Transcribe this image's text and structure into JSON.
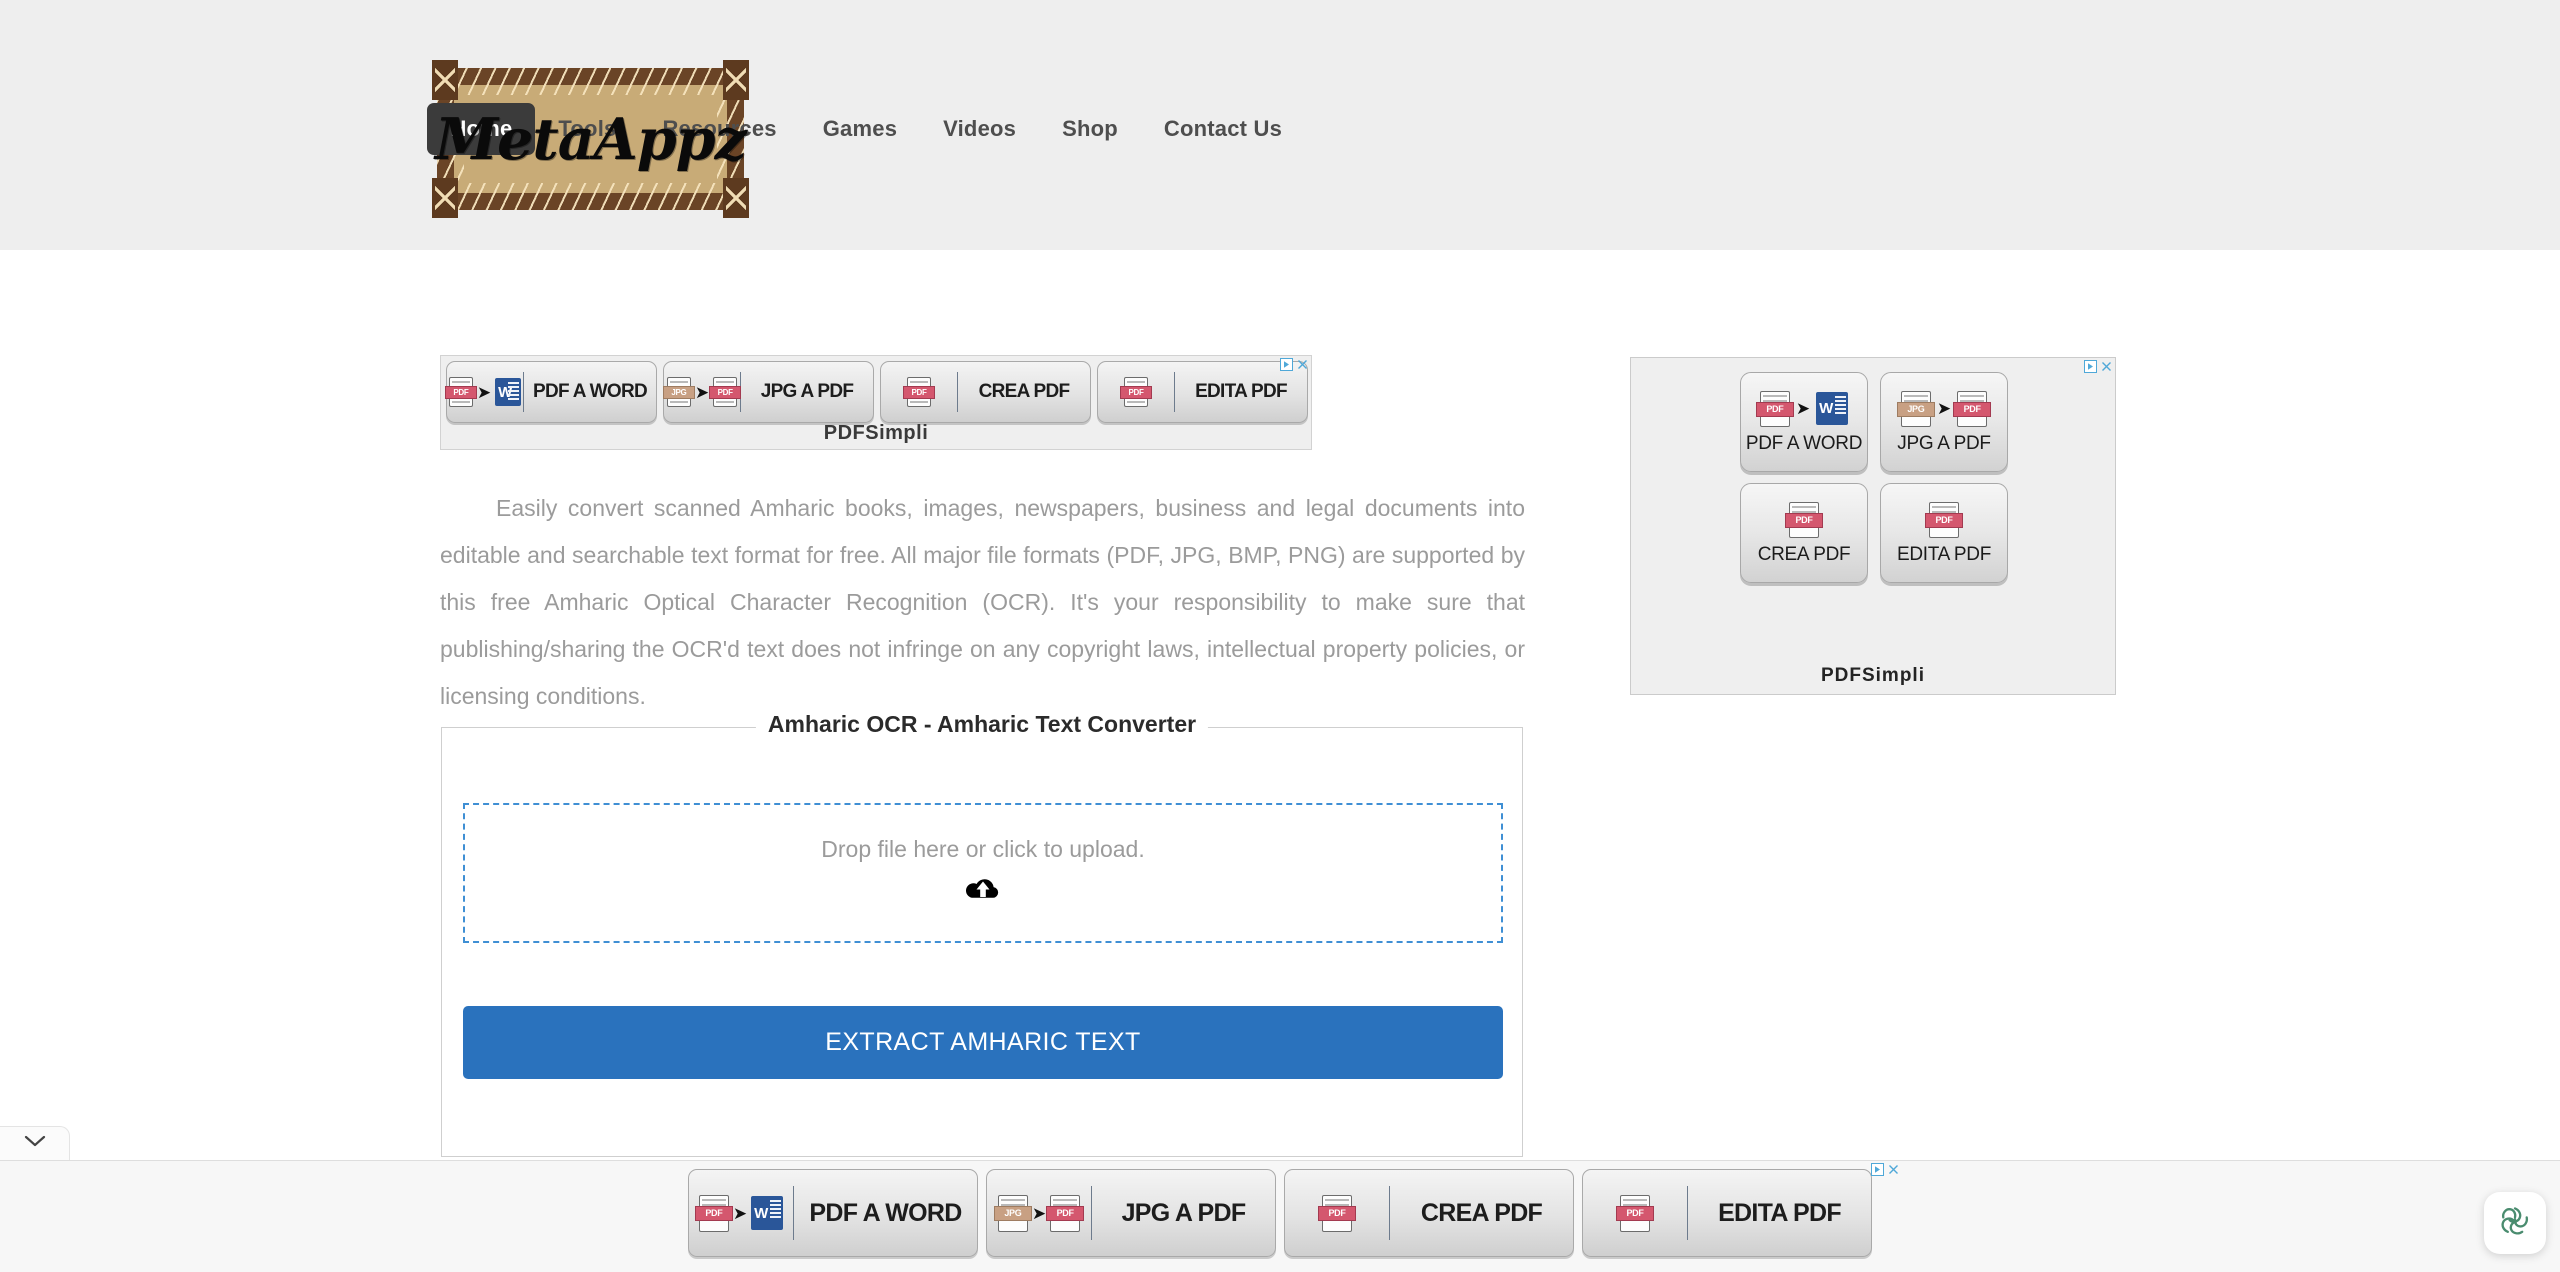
{
  "header": {
    "logo_text": "MetaAppz",
    "logo_alt": "MetaAppz wooden frame logo"
  },
  "nav": {
    "items": [
      {
        "label": "Home",
        "active": true
      },
      {
        "label": "Tools",
        "active": false
      },
      {
        "label": "Resources",
        "active": false
      },
      {
        "label": "Games",
        "active": false
      },
      {
        "label": "Videos",
        "active": false
      },
      {
        "label": "Shop",
        "active": false
      },
      {
        "label": "Contact Us",
        "active": false
      }
    ]
  },
  "intro": {
    "paragraph": "Easily convert scanned Amharic books, images, newspapers, business and legal documents into editable and searchable text format for free. All major file formats (PDF, JPG, BMP, PNG) are supported by this free Amharic Optical Character Recognition (OCR). It's your responsibility to make sure that publishing/sharing the OCR'd text does not infringe on any copyright laws, intellectual property policies, or licensing conditions."
  },
  "ocr": {
    "legend": "Amharic OCR - Amharic Text Converter",
    "dropzone_text": "Drop file here or click to upload.",
    "upload_icon": "cloud-upload-icon",
    "extract_button": "EXTRACT AMHARIC TEXT",
    "accent_color": "#2a72bd",
    "dropzone_border_color": "#3f8fd4"
  },
  "ad_leaderboard": {
    "caption": "PDFSimpli",
    "buttons": [
      {
        "label": "PDF A WORD",
        "icons": [
          "pdf-file-icon",
          "arrow-right-icon",
          "word-file-icon"
        ]
      },
      {
        "label": "JPG A PDF",
        "icons": [
          "jpg-file-icon",
          "arrow-right-icon",
          "pdf-file-icon"
        ]
      },
      {
        "label": "CREA PDF",
        "icons": [
          "pdf-file-icon"
        ]
      },
      {
        "label": "EDITA PDF",
        "icons": [
          "pdf-file-icon"
        ]
      }
    ],
    "adchoices_label": "AdChoices",
    "close_label": "×"
  },
  "ad_sidebar": {
    "caption": "PDFSimpli",
    "buttons": [
      {
        "label": "PDF A WORD",
        "icons": [
          "pdf-file-icon",
          "arrow-right-icon",
          "word-file-icon"
        ]
      },
      {
        "label": "JPG A PDF",
        "icons": [
          "jpg-file-icon",
          "arrow-right-icon",
          "pdf-file-icon"
        ]
      },
      {
        "label": "CREA PDF",
        "icons": [
          "pdf-file-icon"
        ]
      },
      {
        "label": "EDITA PDF",
        "icons": [
          "pdf-file-icon"
        ]
      }
    ],
    "adchoices_label": "AdChoices",
    "close_label": "×"
  },
  "ad_bottom": {
    "buttons": [
      {
        "label": "PDF A WORD",
        "icons": [
          "pdf-file-icon",
          "arrow-right-icon",
          "word-file-icon"
        ]
      },
      {
        "label": "JPG A PDF",
        "icons": [
          "jpg-file-icon",
          "arrow-right-icon",
          "pdf-file-icon"
        ]
      },
      {
        "label": "CREA PDF",
        "icons": [
          "pdf-file-icon"
        ]
      },
      {
        "label": "EDITA PDF",
        "icons": [
          "pdf-file-icon"
        ]
      }
    ],
    "adchoices_label": "AdChoices",
    "close_label": "×"
  },
  "file_tags": {
    "pdf": "PDF",
    "jpg": "JPG",
    "word": "W"
  },
  "collapse_tab": {
    "icon": "chevron-down-icon"
  },
  "float_widget": {
    "icon": "pinwheel-logo-icon",
    "color": "#4a8c6f"
  },
  "colors": {
    "header_bg": "#eeeeee",
    "nav_active_bg": "#3b3b3b",
    "body_text": "#9b9b9b",
    "button_blue": "#2a72bd"
  }
}
